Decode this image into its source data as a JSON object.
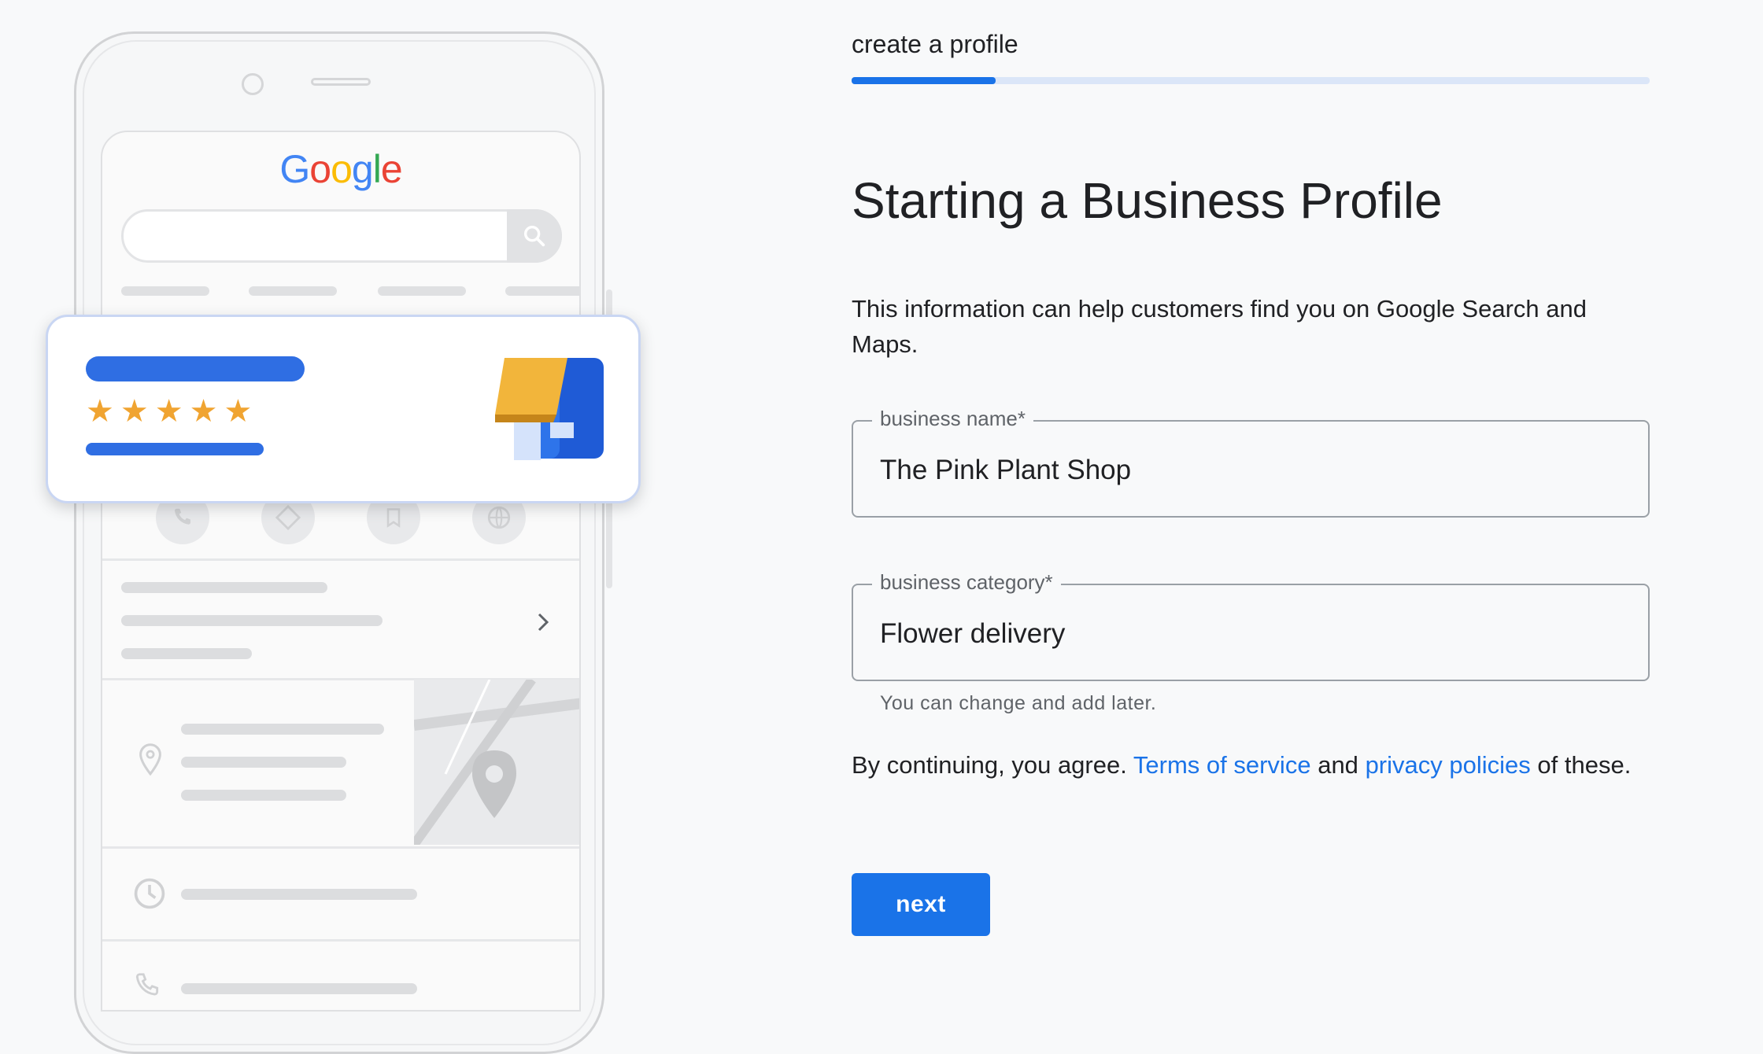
{
  "illustration": {
    "logo_letters": [
      {
        "char": "G",
        "color": "#4285f4"
      },
      {
        "char": "o",
        "color": "#ea4335"
      },
      {
        "char": "o",
        "color": "#fbbc05"
      },
      {
        "char": "g",
        "color": "#4285f4"
      },
      {
        "char": "l",
        "color": "#34a853"
      },
      {
        "char": "e",
        "color": "#ea4335"
      }
    ],
    "rating_stars": 5,
    "icons": [
      "search-icon",
      "phone-icon",
      "directions-icon",
      "bookmark-icon",
      "globe-icon",
      "chevron-right-icon",
      "location-pin-icon",
      "clock-icon",
      "storefront-icon"
    ]
  },
  "stepper": {
    "label": "create a profile",
    "progress": 0.18
  },
  "page": {
    "title": "Starting a Business Profile",
    "intro": "This information can help customers find you on Google Search and Maps."
  },
  "fields": {
    "business_name": {
      "label": "business name*",
      "value": "The Pink Plant Shop"
    },
    "business_category": {
      "label": "business category*",
      "value": "Flower delivery"
    },
    "category_helper": "You can change and add later."
  },
  "consent": {
    "prefix": "By continuing, you agree.",
    "terms_link": "Terms of service",
    "and": "and",
    "privacy_link": "privacy policies",
    "suffix": "of these."
  },
  "actions": {
    "next_label": "next"
  },
  "colors": {
    "accent": "#1a73e8",
    "star": "#f0a431",
    "card_bar": "#2f6ee3"
  }
}
